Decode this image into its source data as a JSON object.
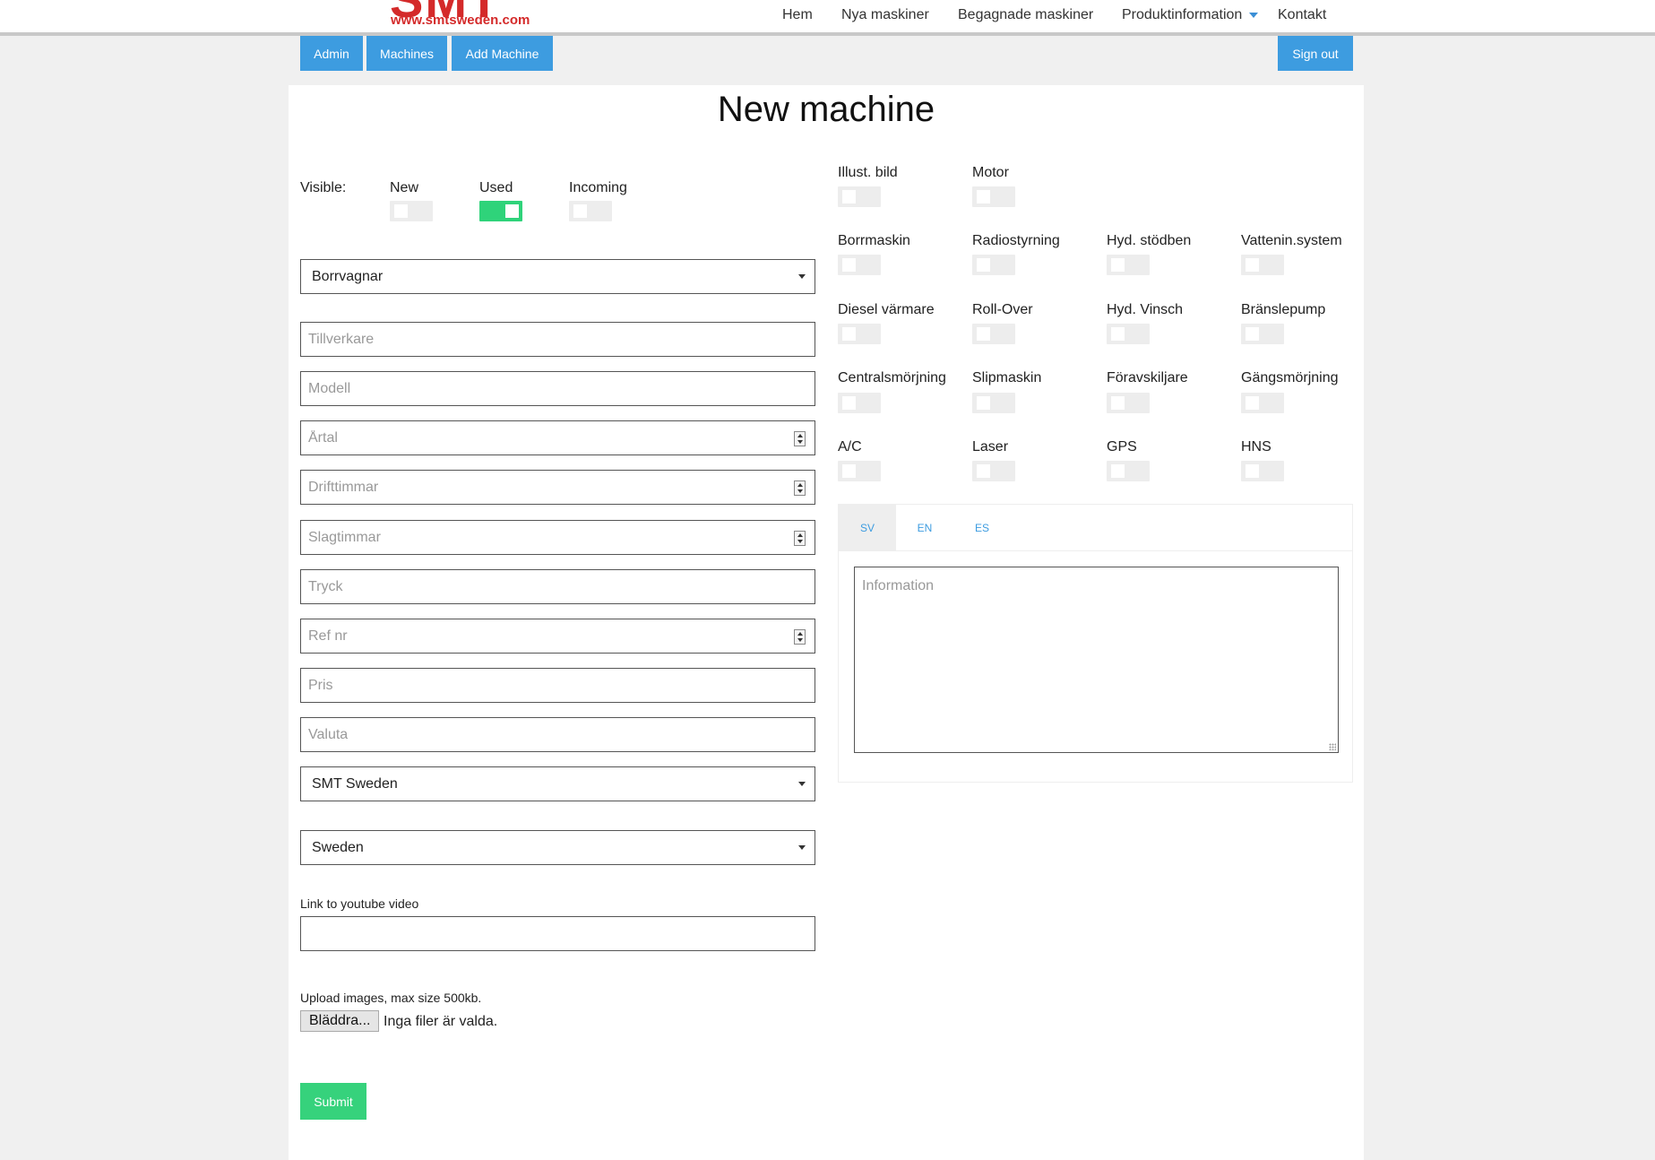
{
  "header": {
    "logo_big": "SMT",
    "logo_url": "www.smtsweden.com",
    "nav": [
      "Hem",
      "Nya maskiner",
      "Begagnade maskiner",
      "Produktinformation",
      "Kontakt"
    ]
  },
  "admin_bar": {
    "admin": "Admin",
    "machines": "Machines",
    "add_machine": "Add Machine",
    "sign_out": "Sign out"
  },
  "page": {
    "title": "New machine"
  },
  "visibility": {
    "label": "Visible:",
    "options": [
      {
        "label": "New",
        "on": false
      },
      {
        "label": "Used",
        "on": true
      },
      {
        "label": "Incoming",
        "on": false
      }
    ]
  },
  "form": {
    "category": "Borrvagnar",
    "placeholders": {
      "manufacturer": "Tillverkare",
      "model": "Modell",
      "year": "Årtal",
      "operating_hours": "Drifttimmar",
      "percussion_hours": "Slagtimmar",
      "pressure": "Tryck",
      "ref_nr": "Ref nr",
      "price": "Pris",
      "currency": "Valuta"
    },
    "seller": "SMT Sweden",
    "country": "Sweden",
    "youtube_label": "Link to youtube video",
    "youtube_value": "",
    "upload_label": "Upload images, max size 500kb.",
    "browse_button": "Bläddra...",
    "no_files": "Inga filer är valda.",
    "submit": "Submit"
  },
  "features": {
    "top": [
      "Illust. bild",
      "Motor"
    ],
    "grid": [
      "Borrmaskin",
      "Radiostyrning",
      "Hyd. stödben",
      "Vattenin.system",
      "Diesel värmare",
      "Roll-Over",
      "Hyd. Vinsch",
      "Bränslepump",
      "Centralsmörjning",
      "Slipmaskin",
      "Föravskiljare",
      "Gängsmörjning",
      "A/C",
      "Laser",
      "GPS",
      "HNS"
    ]
  },
  "info_tabs": {
    "tabs": [
      "SV",
      "EN",
      "ES"
    ],
    "active": "SV",
    "placeholder": "Information"
  },
  "colors": {
    "accent_blue": "#3d9ce0",
    "toggle_on": "#2fd37a",
    "submit_green": "#36d27c",
    "logo_red": "#d42a2a"
  }
}
